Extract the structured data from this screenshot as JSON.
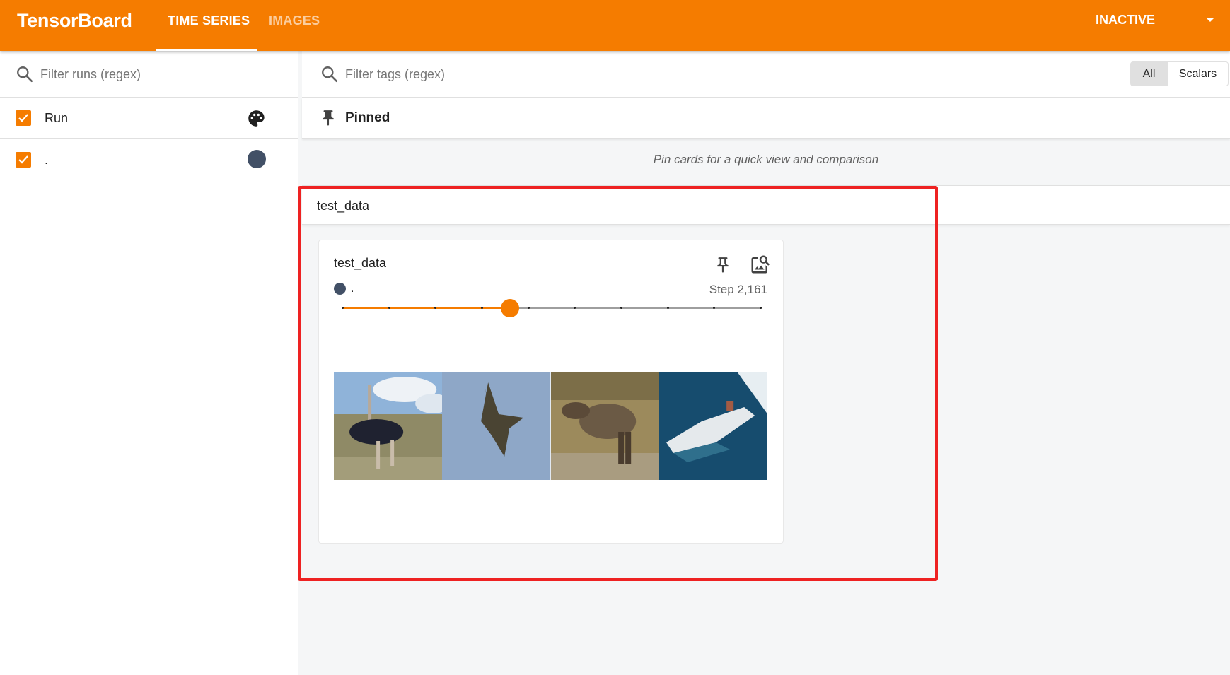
{
  "app": {
    "title": "TensorBoard",
    "tabs": [
      {
        "label": "TIME SERIES",
        "active": true
      },
      {
        "label": "IMAGES",
        "active": false
      }
    ],
    "status_select": "INACTIVE",
    "accent_color": "#f57c00",
    "run_color": "#425066"
  },
  "runs_panel": {
    "filter_placeholder": "Filter runs (regex)",
    "header_label": "Run",
    "header_icon": "palette-icon",
    "runs": [
      {
        "name": ".",
        "checked": true,
        "color": "#425066"
      }
    ]
  },
  "main": {
    "tag_filter_placeholder": "Filter tags (regex)",
    "type_filters": [
      "All",
      "Scalars"
    ],
    "type_filter_selected": "All",
    "pinned": {
      "label": "Pinned",
      "hint": "Pin cards for a quick view and comparison"
    },
    "group": {
      "title": "test_data",
      "card": {
        "title": "test_data",
        "run_name": ".",
        "step_label": "Step 2,161",
        "slider": {
          "position": 0.4,
          "tick_count": 10
        },
        "images": [
          {
            "subject": "ostrich"
          },
          {
            "subject": "bird in flight"
          },
          {
            "subject": "deer"
          },
          {
            "subject": "boat"
          }
        ]
      }
    }
  }
}
